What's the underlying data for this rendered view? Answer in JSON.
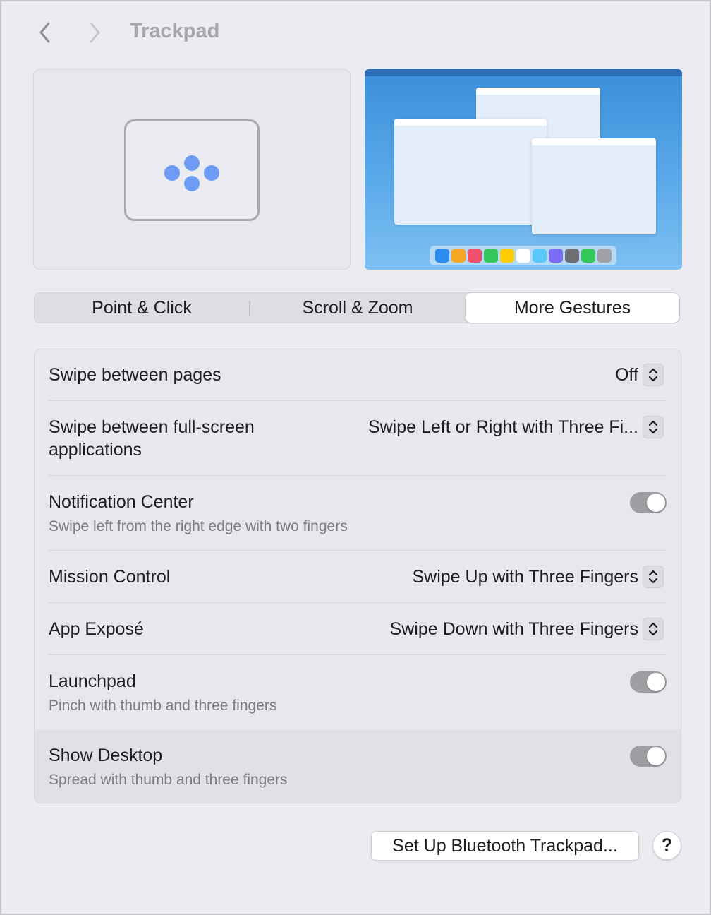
{
  "header": {
    "title": "Trackpad",
    "back_icon": "chevron-left-icon",
    "forward_icon": "chevron-right-icon"
  },
  "preview": {
    "trackpad_icon": "four-finger-trackpad-icon",
    "screen": "desktop-preview",
    "dock_colors": [
      "#2d8cf0",
      "#f5a623",
      "#f0506e",
      "#34c759",
      "#ffcc00",
      "#ffffff",
      "#5ac8fa",
      "#7b6cf6",
      "#6e6e73",
      "#34c759",
      "#a0a0a5"
    ]
  },
  "tabs": [
    {
      "label": "Point & Click",
      "selected": false
    },
    {
      "label": "Scroll & Zoom",
      "selected": false
    },
    {
      "label": "More Gestures",
      "selected": true
    }
  ],
  "settings": {
    "swipe_pages": {
      "label": "Swipe between pages",
      "value": "Off"
    },
    "swipe_fullscreen": {
      "label_line1": "Swipe between full-screen",
      "label_line2": "applications",
      "value": "Swipe Left or Right with Three Fi..."
    },
    "notification_center": {
      "label": "Notification Center",
      "sub": "Swipe left from the right edge with two fingers",
      "enabled": true
    },
    "mission_control": {
      "label": "Mission Control",
      "value": "Swipe Up with Three Fingers"
    },
    "app_expose": {
      "label": "App Exposé",
      "value": "Swipe Down with Three Fingers"
    },
    "launchpad": {
      "label": "Launchpad",
      "sub": "Pinch with thumb and three fingers",
      "enabled": true
    },
    "show_desktop": {
      "label": "Show Desktop",
      "sub": "Spread with thumb and three fingers",
      "enabled": true
    }
  },
  "footer": {
    "setup_label": "Set Up Bluetooth Trackpad...",
    "help_label": "?"
  },
  "colors": {
    "accent_dots": "#6e9bf6",
    "toggle_track": "#9e9ea3",
    "desktop_blue": "#3a8fd9"
  }
}
